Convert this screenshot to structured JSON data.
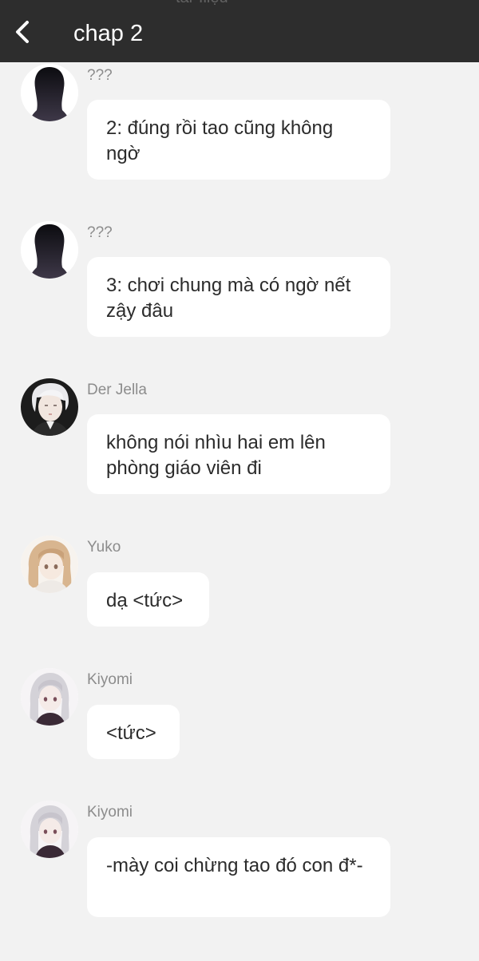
{
  "header": {
    "title": "chap 2",
    "ghost_text": "tar Iliệu",
    "background": "#2d2d2d"
  },
  "messages": [
    {
      "sender": "???",
      "avatar": "silhouette-icon",
      "text": "2: đúng rồi tao cũng không ngờ"
    },
    {
      "sender": "???",
      "avatar": "silhouette-icon",
      "text": "3: chơi chung mà có ngờ nết zậy đâu"
    },
    {
      "sender": "Der Jella",
      "avatar": "der-jella-avatar",
      "text": "không nói nhìu hai em lên phòng giáo viên đi"
    },
    {
      "sender": "Yuko",
      "avatar": "yuko-avatar",
      "text": "dạ <tức>"
    },
    {
      "sender": "Kiyomi",
      "avatar": "kiyomi-avatar",
      "text": "<tức>"
    },
    {
      "sender": "Kiyomi",
      "avatar": "kiyomi-avatar",
      "text": "-mày coi chừng tao đó con đ*-"
    }
  ],
  "colors": {
    "page_background": "#f2f2f2",
    "bubble_background": "#ffffff",
    "sender_text": "#8c8c8c",
    "message_text": "#2b2b2b"
  }
}
